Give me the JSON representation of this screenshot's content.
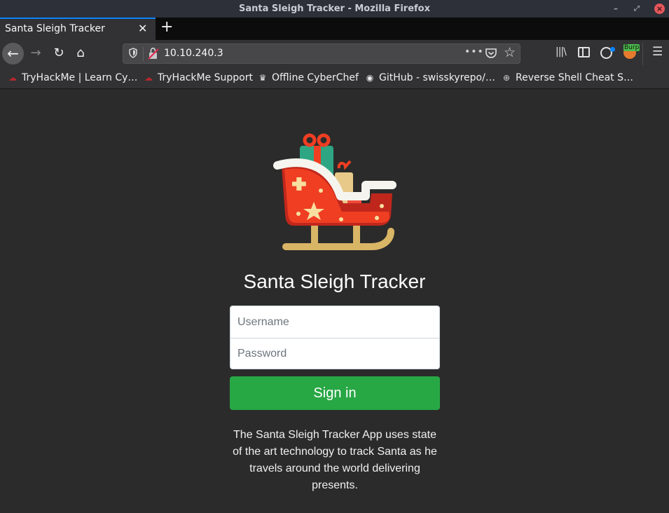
{
  "window": {
    "title": "Santa Sleigh Tracker - Mozilla Firefox",
    "controls": {
      "minimize": "–",
      "maximize": "⤢",
      "close": "×"
    }
  },
  "tabs": [
    {
      "label": "Santa Sleigh Tracker",
      "active": true,
      "close_glyph": "✕"
    }
  ],
  "new_tab_glyph": "+",
  "nav": {
    "back_glyph": "←",
    "forward_glyph": "→",
    "reload_glyph": "↻",
    "home_glyph": "⌂",
    "url": "10.10.240.3",
    "page_actions_glyph": "•••",
    "bookmark_glyph": "☆",
    "library_glyph": "|||\\",
    "menu_glyph": "☰",
    "extension_badge": "Burp"
  },
  "bookmarks": [
    {
      "label": "TryHackMe | Learn Cy…",
      "icon": "tryhackme-icon"
    },
    {
      "label": "TryHackMe Support",
      "icon": "tryhackme-icon"
    },
    {
      "label": "Offline CyberChef",
      "icon": "chef-hat-icon"
    },
    {
      "label": "GitHub - swisskyrepo/…",
      "icon": "github-icon"
    },
    {
      "label": "Reverse Shell Cheat S…",
      "icon": "globe-icon"
    }
  ],
  "page": {
    "heading": "Santa Sleigh Tracker",
    "username_placeholder": "Username",
    "username_value": "",
    "password_placeholder": "Password",
    "password_value": "",
    "signin_label": "Sign in",
    "description": "The Santa Sleigh Tracker App uses state of the art technology to track Santa as he travels around the world delivering presents."
  },
  "colors": {
    "accent_tab": "#0a84ff",
    "signin_bg": "#28a745",
    "page_bg": "#2b2b2b",
    "close_button": "#e5575b"
  }
}
